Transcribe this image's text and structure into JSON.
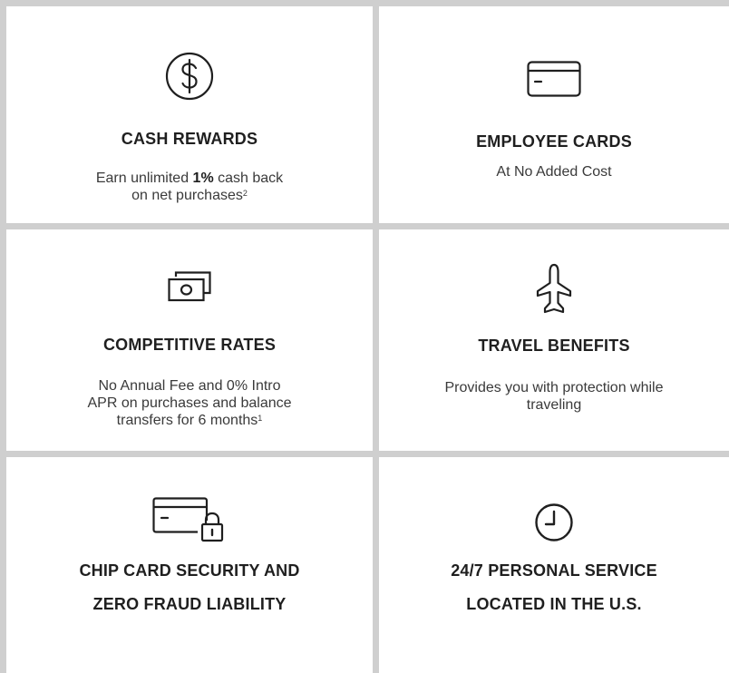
{
  "features": {
    "cash_rewards": {
      "icon": "dollar-icon",
      "title": "CASH REWARDS",
      "desc_pre": "Earn unlimited ",
      "desc_bold": "1%",
      "desc_mid": " cash back",
      "desc_line2": "on net purchases",
      "desc_sup": "2"
    },
    "employee_cards": {
      "icon": "credit-card-icon",
      "title": "EMPLOYEE CARDS",
      "desc": "At No Added Cost"
    },
    "competitive_rates": {
      "icon": "cash-bills-icon",
      "title": "COMPETITIVE RATES",
      "desc_line1": "No Annual Fee and 0% Intro",
      "desc_line2": "APR on purchases and balance",
      "desc_line3": "transfers for 6 months",
      "desc_sup": "1"
    },
    "travel_benefits": {
      "icon": "airplane-icon",
      "title": "TRAVEL BENEFITS",
      "desc_line1": "Provides you with protection while",
      "desc_line2": "traveling"
    },
    "chip_security": {
      "icon": "card-lock-icon",
      "title_line1": "CHIP CARD SECURITY AND",
      "title_line2": "ZERO FRAUD LIABILITY"
    },
    "personal_service": {
      "icon": "clock-icon",
      "title_line1": "24/7 PERSONAL SERVICE",
      "title_line2": "LOCATED IN THE U.S."
    }
  },
  "colors": {
    "background": "#cfcfcf",
    "panel": "#ffffff",
    "text": "#1f1f1f"
  }
}
